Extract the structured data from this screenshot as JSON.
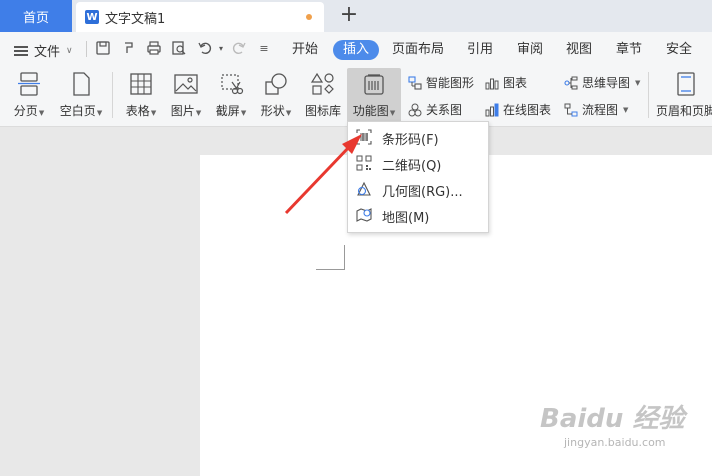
{
  "tabs": {
    "home": "首页",
    "document": "文字文稿1",
    "new_tab": "+"
  },
  "menubar": {
    "file": "文件",
    "tabs": [
      "开始",
      "插入",
      "页面布局",
      "引用",
      "审阅",
      "视图",
      "章节",
      "安全"
    ],
    "active_tab": "插入"
  },
  "ribbon": {
    "page_break": "分页",
    "blank_page": "空白页",
    "table": "表格",
    "picture": "图片",
    "screenshot": "截屏",
    "shape": "形状",
    "icon_library": "图标库",
    "function_chart": "功能图",
    "smart_graphic": "智能图形",
    "chart": "图表",
    "mind_map": "思维导图",
    "relation_chart": "关系图",
    "online_chart": "在线图表",
    "flowchart": "流程图",
    "header_footer": "页眉和页脚"
  },
  "dropdown": {
    "items": [
      {
        "label": "条形码(F)"
      },
      {
        "label": "二维码(Q)"
      },
      {
        "label": "几何图(RG)..."
      },
      {
        "label": "地图(M)"
      }
    ]
  },
  "watermark": {
    "main": "Baidu 经验",
    "sub": "jingyan.baidu.com"
  },
  "colors": {
    "accent": "#3f7ee8",
    "annotation_arrow": "#e8382f"
  }
}
